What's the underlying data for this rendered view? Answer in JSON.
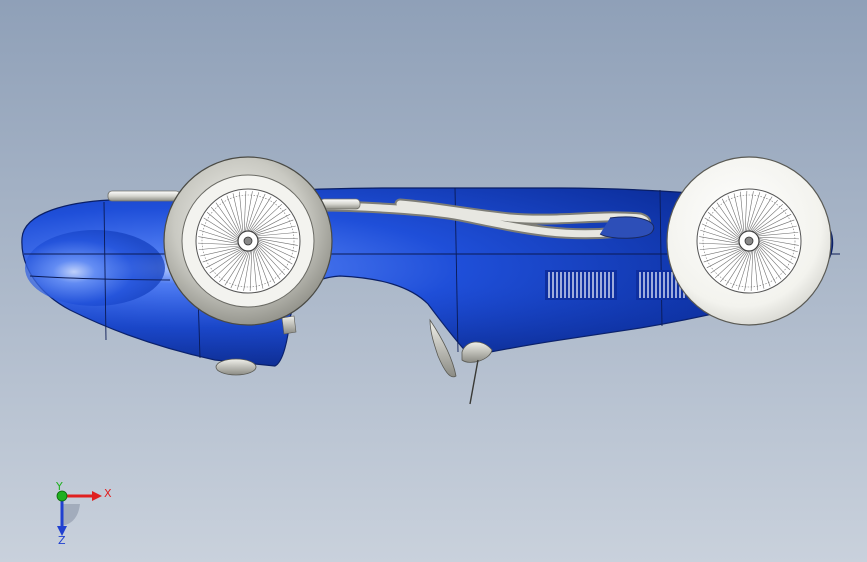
{
  "viewport": {
    "model": "race-car-3d-model",
    "body_color": "#1f4fd9",
    "tire_color": "#d4d4d0",
    "spoke_color": "#6d6d6d",
    "background_top": "#8fa0b8",
    "background_bottom": "#c9d1dc"
  },
  "triad": {
    "x_label": "X",
    "y_label": "Y",
    "z_label": "Z",
    "x_color": "#e02020",
    "y_color": "#20b020",
    "z_color": "#2040d0"
  }
}
